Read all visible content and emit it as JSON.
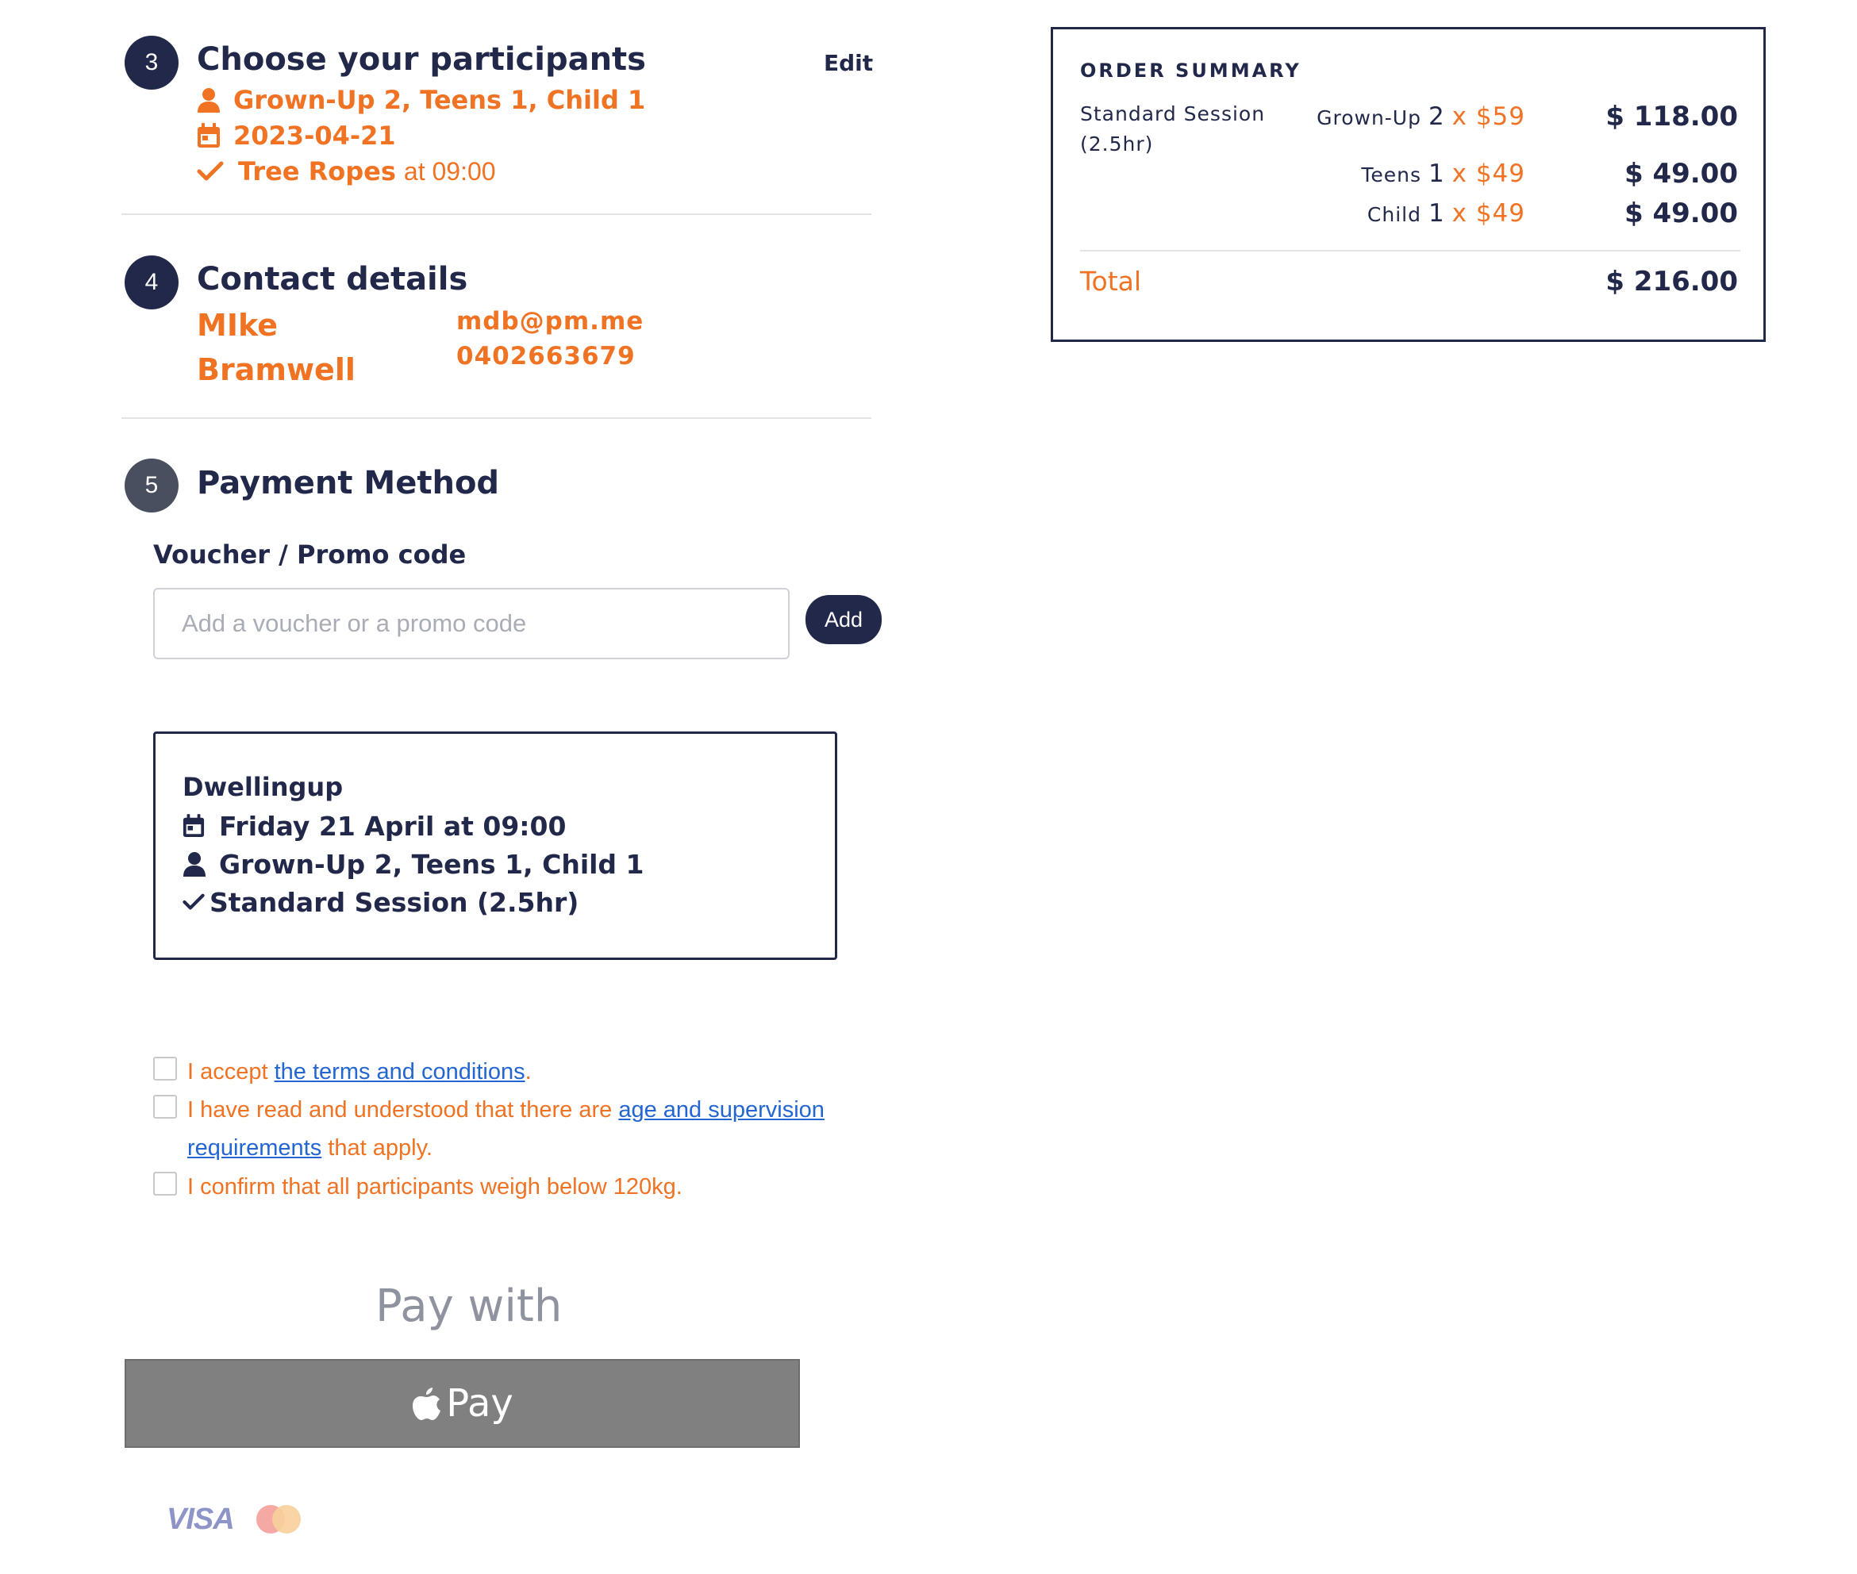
{
  "steps": {
    "participants": {
      "number": "3",
      "title": "Choose your participants",
      "edit_label": "Edit",
      "participants_summary": "Grown-Up 2, Teens 1, Child 1",
      "date": "2023-04-21",
      "activity": "Tree Ropes",
      "time_text": "at 09:00"
    },
    "contact": {
      "number": "4",
      "title": "Contact details",
      "first_name": "MIke",
      "last_name": "Bramwell",
      "email": "mdb@pm.me",
      "phone": "0402663679"
    },
    "payment": {
      "number": "5",
      "title": "Payment Method",
      "voucher_label": "Voucher / Promo code",
      "voucher_placeholder": "Add a voucher or a promo code",
      "voucher_value": "",
      "add_label": "Add"
    }
  },
  "booking_summary": {
    "location": "Dwellingup",
    "datetime": "Friday 21 April at 09:00",
    "participants": "Grown-Up 2, Teens 1, Child 1",
    "session": "Standard Session (2.5hr)"
  },
  "agreements": {
    "terms_prefix": "I accept ",
    "terms_link": "the terms and conditions",
    "terms_suffix": ".",
    "age_prefix": "I have read and understood that there are ",
    "age_link_1": "age and supervision",
    "age_link_2": "requirements",
    "age_suffix": " that apply.",
    "weight_text": "I confirm that all participants weigh below 120kg."
  },
  "payment_options": {
    "pay_with_label": "Pay with",
    "apple_pay_label": "Pay",
    "card_brands": [
      "VISA",
      "mastercard"
    ]
  },
  "order_summary": {
    "heading": "ORDER SUMMARY",
    "item_name_1": "Standard Session",
    "item_name_2": "(2.5hr)",
    "lines": [
      {
        "category": "Grown-Up",
        "qty": "2",
        "unit_price": "x $59",
        "amount": "$ 118.00"
      },
      {
        "category": "Teens",
        "qty": "1",
        "unit_price": "x $49",
        "amount": "$ 49.00"
      },
      {
        "category": "Child",
        "qty": "1",
        "unit_price": "x $49",
        "amount": "$ 49.00"
      }
    ],
    "total_label": "Total",
    "total_amount": "$ 216.00"
  },
  "colors": {
    "brand_navy": "#22284a",
    "accent_orange": "#f07223",
    "link_blue": "#2366d1",
    "apple_pay_grey": "#808080"
  },
  "icons": [
    "user-icon",
    "calendar-icon",
    "checkmark-icon",
    "apple-logo-icon",
    "visa-logo-icon",
    "mastercard-logo-icon"
  ]
}
